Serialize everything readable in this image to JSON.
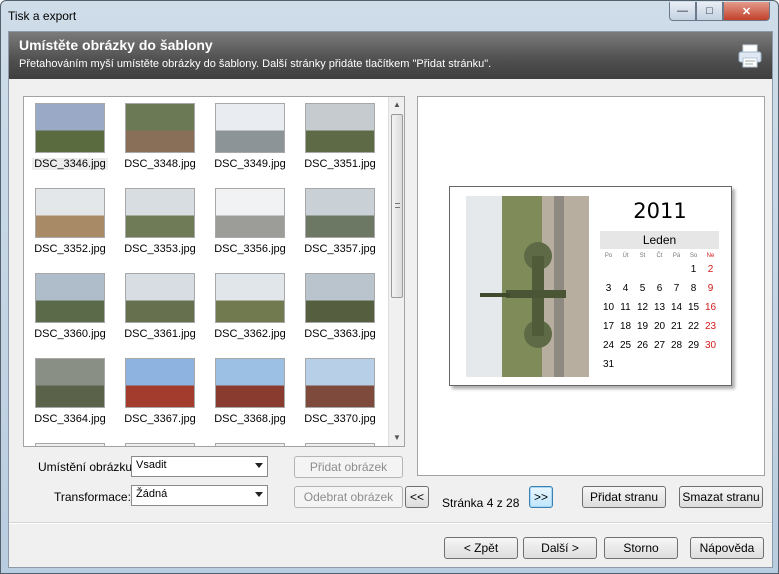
{
  "window": {
    "title": "Tisk a export"
  },
  "header": {
    "title": "Umístěte obrázky do šablony",
    "subtitle": "Přetahováním myší umístěte obrázky do šablony. Další stránky přidáte tlačítkem \"Přidat stránku\"."
  },
  "thumbnails": [
    {
      "name": "DSC_3346.jpg"
    },
    {
      "name": "DSC_3348.jpg"
    },
    {
      "name": "DSC_3349.jpg"
    },
    {
      "name": "DSC_3351.jpg"
    },
    {
      "name": "DSC_3352.jpg"
    },
    {
      "name": "DSC_3353.jpg"
    },
    {
      "name": "DSC_3356.jpg"
    },
    {
      "name": "DSC_3357.jpg"
    },
    {
      "name": "DSC_3360.jpg"
    },
    {
      "name": "DSC_3361.jpg"
    },
    {
      "name": "DSC_3362.jpg"
    },
    {
      "name": "DSC_3363.jpg"
    },
    {
      "name": "DSC_3364.jpg"
    },
    {
      "name": "DSC_3367.jpg"
    },
    {
      "name": "DSC_3368.jpg"
    },
    {
      "name": "DSC_3370.jpg"
    }
  ],
  "calendar": {
    "year": "2011",
    "month": "Leden",
    "days_of_week": [
      "Po",
      "Út",
      "St",
      "Čt",
      "Pá",
      "So",
      "Ne"
    ],
    "weeks": [
      [
        "",
        "",
        "",
        "",
        "",
        "1",
        "2"
      ],
      [
        "3",
        "4",
        "5",
        "6",
        "7",
        "8",
        "9"
      ],
      [
        "10",
        "11",
        "12",
        "13",
        "14",
        "15",
        "16"
      ],
      [
        "17",
        "18",
        "19",
        "20",
        "21",
        "22",
        "23"
      ],
      [
        "24",
        "25",
        "26",
        "27",
        "28",
        "29",
        "30"
      ],
      [
        "31",
        "",
        "",
        "",
        "",
        "",
        ""
      ]
    ]
  },
  "controls": {
    "placement_label": "Umístění obrázku:",
    "placement_value": "Vsadit",
    "transform_label": "Transformace:",
    "transform_value": "Žádná",
    "add_image": "Přidat obrázek",
    "remove_image": "Odebrat obrázek",
    "prev_page": "<<",
    "next_page": ">>",
    "page_indicator": "Stránka 4 z 28",
    "add_page": "Přidat stranu",
    "delete_page": "Smazat stranu"
  },
  "footer": {
    "back": "< Zpět",
    "next": "Další >",
    "cancel": "Storno",
    "help": "Nápověda"
  },
  "colors": {
    "accent_red": "#d11a1a",
    "header_dark": "#4f4f4f"
  }
}
